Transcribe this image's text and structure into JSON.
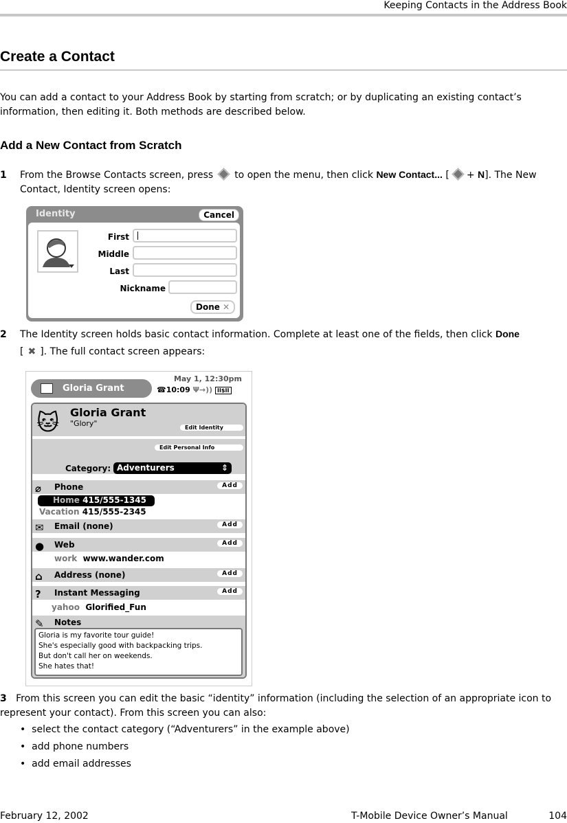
{
  "header": {
    "running_title": "Keeping Contacts in the Address Book"
  },
  "section_title": "Create a Contact",
  "intro": "You can add a contact to your Address Book by starting from scratch; or by duplicating an existing contact’s information, then editing it. Both methods are described below.",
  "subsection_title": "Add a New Contact from Scratch",
  "steps": [
    {
      "num": "1",
      "text_a": "From the Browse Contacts screen, press",
      "text_b": "to open the menu, then click",
      "bold": "New Contact...",
      "text_c": "[",
      "plus": "+",
      "key": "N",
      "text_d": "]. The New Contact, Identity screen opens:"
    },
    {
      "num": "2",
      "text_a": "The Identity screen holds basic contact information. Complete at least one of the fields, then click",
      "bold": "Done",
      "text_b": "[",
      "text_c": "]. The full contact screen appears:"
    },
    {
      "num": "3",
      "text": "From this screen you can edit the basic “identity” information (including the selection of an appropriate icon to represent your contact). From this screen you can also:"
    }
  ],
  "bullets": [
    "select the contact category (“Adventurers” in the example above)",
    "add phone numbers",
    "add email addresses"
  ],
  "identity_screen": {
    "title": "Identity",
    "cancel": "Cancel",
    "fields": {
      "first": "First",
      "middle": "Middle",
      "last": "Last",
      "nickname": "Nickname"
    },
    "done": "Done"
  },
  "contact_screen": {
    "tab_title": "Gloria Grant",
    "date": "May 1, 12:30pm",
    "time": "10:09",
    "name": "Gloria Grant",
    "nickname": "\"Glory\"",
    "edit_identity": "Edit Identity",
    "edit_personal": "Edit Personal Info",
    "category_label": "Category:",
    "category_value": "Adventurers",
    "phone": {
      "label": "Phone",
      "add": "Add",
      "entries": [
        {
          "type": "Home",
          "value": "415/555-1345"
        },
        {
          "type": "Vacation",
          "value": "415/555-2345"
        }
      ]
    },
    "email": {
      "label": "Email (none)",
      "add": "Add"
    },
    "web": {
      "label": "Web",
      "add": "Add",
      "type": "work",
      "value": "www.wander.com"
    },
    "address": {
      "label": "Address (none)",
      "add": "Add"
    },
    "im": {
      "label": "Instant Messaging",
      "add": "Add",
      "type": "yahoo",
      "value": "Glorified_Fun"
    },
    "notes": {
      "label": "Notes",
      "lines": [
        "Gloria is my favorite tour guide!",
        "She's especially good with backpacking trips.",
        "But don't call her on weekends.",
        "She hates that!"
      ]
    }
  },
  "footer": {
    "date": "February 12, 2002",
    "manual": "T-Mobile Device Owner’s Manual",
    "page": "104"
  }
}
